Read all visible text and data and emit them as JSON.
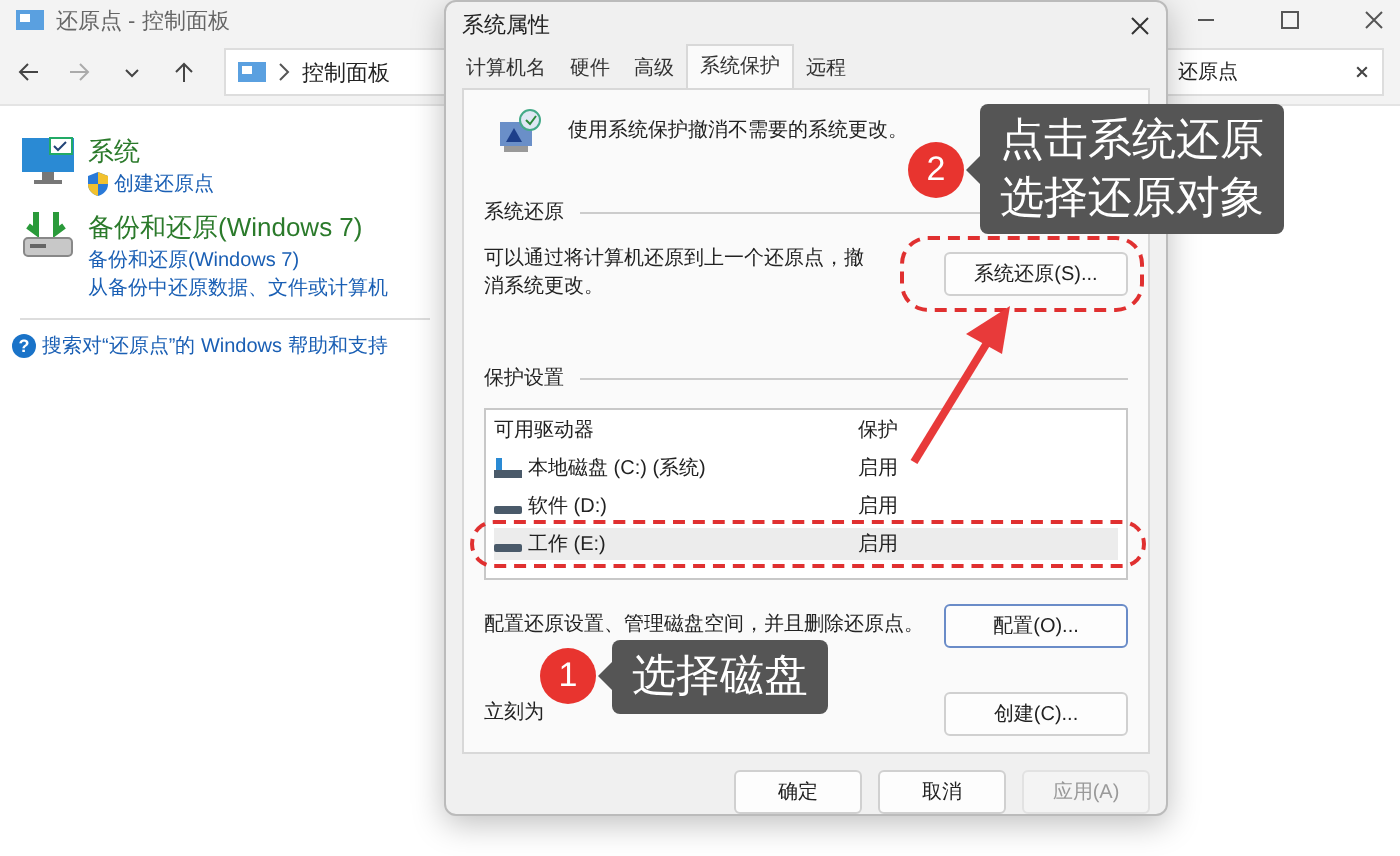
{
  "explorer": {
    "title": "还原点 - 控制面板",
    "breadcrumb": "控制面板",
    "search": {
      "value": "还原点"
    },
    "items": [
      {
        "kind": "system",
        "title": "系统",
        "links": [
          {
            "text": "创建还原点",
            "shield": true
          }
        ]
      },
      {
        "kind": "backup",
        "title": "备份和还原(Windows 7)",
        "links": [
          {
            "text": "备份和还原(Windows 7)",
            "shield": false
          },
          {
            "text": "从备份中还原数据、文件或计算机",
            "shield": false
          }
        ]
      }
    ],
    "help_icon": "?",
    "help_link": "搜索对“还原点”的 Windows 帮助和支持"
  },
  "dialog": {
    "title": "系统属性",
    "tabs": [
      {
        "label": "计算机名",
        "selected": false
      },
      {
        "label": "硬件",
        "selected": false
      },
      {
        "label": "高级",
        "selected": false
      },
      {
        "label": "系统保护",
        "selected": true
      },
      {
        "label": "远程",
        "selected": false
      }
    ],
    "intro": "使用系统保护撤消不需要的系统更改。",
    "restore_group": {
      "title": "系统还原",
      "text": "可以通过将计算机还原到上一个还原点，撤消系统更改。",
      "button": "系统还原(S)..."
    },
    "protection_group": {
      "title": "保护设置",
      "columns": [
        "可用驱动器",
        "保护"
      ],
      "drives": [
        {
          "kind": "system",
          "name": "本地磁盘 (C:) (系统)",
          "protection": "启用",
          "selected": false
        },
        {
          "kind": "data",
          "name": "软件 (D:)",
          "protection": "启用",
          "selected": false
        },
        {
          "kind": "data",
          "name": "工作 (E:)",
          "protection": "启用",
          "selected": true
        }
      ],
      "actions": [
        {
          "text": "配置还原设置、管理磁盘空间，并且删除还原点。",
          "button": "配置(O)..."
        },
        {
          "text": "立刻为",
          "button": "创建(C)..."
        }
      ]
    },
    "buttons": [
      {
        "label": "确定",
        "disabled": false
      },
      {
        "label": "取消",
        "disabled": false
      },
      {
        "label": "应用(A)",
        "disabled": true
      }
    ]
  },
  "callouts": [
    {
      "number": "2",
      "lines": [
        "点击系统还原",
        "选择还原对象"
      ]
    },
    {
      "number": "1",
      "lines": [
        "选择磁盘"
      ]
    }
  ]
}
